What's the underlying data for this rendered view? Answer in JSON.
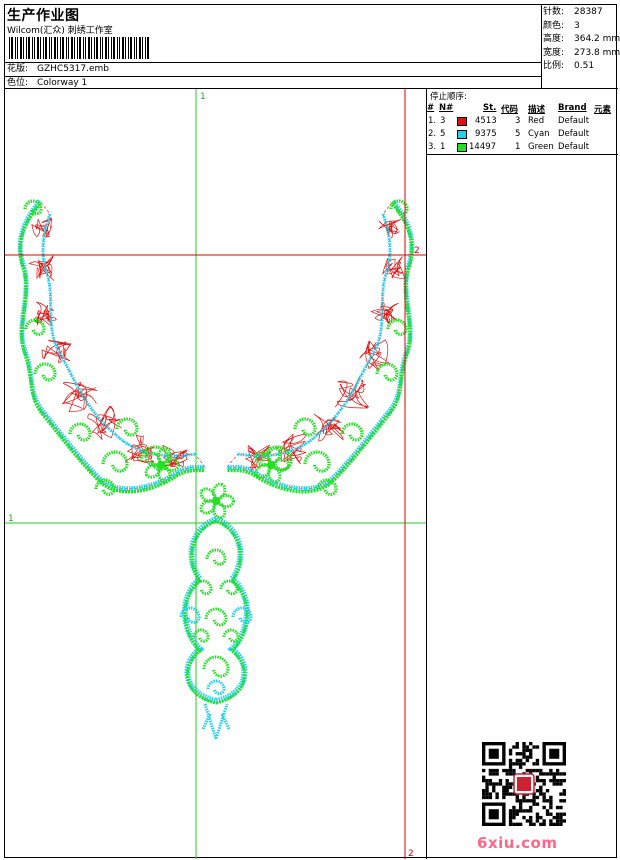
{
  "header": {
    "title": "生产作业图",
    "studio": "Wilcom(汇众) 刺绣工作室",
    "design_label": "花版:",
    "design_value": "GZHC5317.emb",
    "colorway_label": "色位:",
    "colorway_value": "Colorway 1"
  },
  "stats": [
    {
      "label": "针数:",
      "value": "28387"
    },
    {
      "label": "颜色:",
      "value": "3"
    },
    {
      "label": "高度:",
      "value": "364.2 mm"
    },
    {
      "label": "宽度:",
      "value": "273.8 mm"
    },
    {
      "label": "比例:",
      "value": "0.51"
    }
  ],
  "stop_sequence": {
    "title": "停止顺序:",
    "headers": {
      "num": "#",
      "n": "N#",
      "st": "St.",
      "code": "代码",
      "desc": "描述",
      "brand": "Brand",
      "element": "元素"
    },
    "rows": [
      {
        "num": "1.",
        "n": "3",
        "color": "#e01010",
        "st": "4513",
        "code": "3",
        "desc": "Red",
        "brand": "Default"
      },
      {
        "num": "2.",
        "n": "5",
        "color": "#22d0f0",
        "st": "9375",
        "code": "5",
        "desc": "Cyan",
        "brand": "Default"
      },
      {
        "num": "3.",
        "n": "1",
        "color": "#22e022",
        "st": "14497",
        "code": "1",
        "desc": "Green",
        "brand": "Default"
      }
    ]
  },
  "guides": {
    "v1_label": "1",
    "v2_label": "2",
    "h1_label": "1",
    "h2_label": "2",
    "guide_green": "#22cc22",
    "guide_red": "#dd0000"
  },
  "watermark": {
    "site": "6xiu.com",
    "color": "#ff6688",
    "qr_icon": "qr-code-icon"
  }
}
